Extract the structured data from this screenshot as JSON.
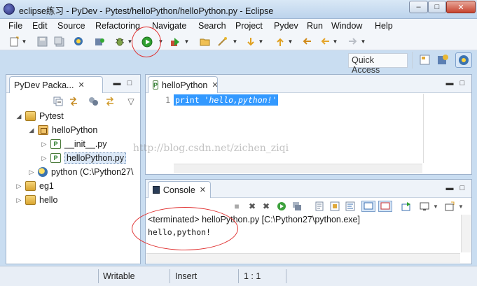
{
  "window": {
    "title": "eclipse练习 - PyDev - Pytest/helloPython/helloPython.py - Eclipse",
    "min_glyph": "–",
    "max_glyph": "□",
    "close_glyph": "✕"
  },
  "menu": [
    "File",
    "Edit",
    "Source",
    "Refactoring",
    "Navigate",
    "Search",
    "Project",
    "Pydev",
    "Run",
    "Window",
    "Help"
  ],
  "toolbar": {
    "quick_access_label": "Quick Access"
  },
  "package_explorer": {
    "tab_label": "PyDev Packa...",
    "tree": [
      {
        "label": "Pytest",
        "twisty": "◢",
        "icon": "project-icon"
      },
      {
        "label": "helloPython",
        "twisty": "◢",
        "icon": "package-icon"
      },
      {
        "label": "__init__.py",
        "twisty": "▷",
        "icon": "python-file-icon"
      },
      {
        "label": "helloPython.py",
        "twisty": "▷",
        "icon": "python-file-icon",
        "selected": true
      },
      {
        "label": "python  (C:\\Python27\\",
        "twisty": "▷",
        "icon": "python-interpreter-icon"
      },
      {
        "label": "eg1",
        "twisty": "▷",
        "icon": "project-icon"
      },
      {
        "label": "hello",
        "twisty": "▷",
        "icon": "project-icon"
      }
    ]
  },
  "editor": {
    "tab_label": "helloPython",
    "line_number": "1",
    "code_keyword": "print ",
    "code_string": "'hello,python!'"
  },
  "console": {
    "tab_label": "Console",
    "terminated_text": "<terminated> helloPython.py [C:\\Python27\\python.exe]",
    "output_text": "hello,python!"
  },
  "watermark": "http://blog.csdn.net/zichen_ziqi",
  "statusbar": {
    "writable": "Writable",
    "insert_mode": "Insert",
    "position": "1 : 1"
  },
  "colors": {
    "selection": "#3399ff",
    "annotation_red": "#e03030",
    "run_green": "#2fa02f"
  }
}
